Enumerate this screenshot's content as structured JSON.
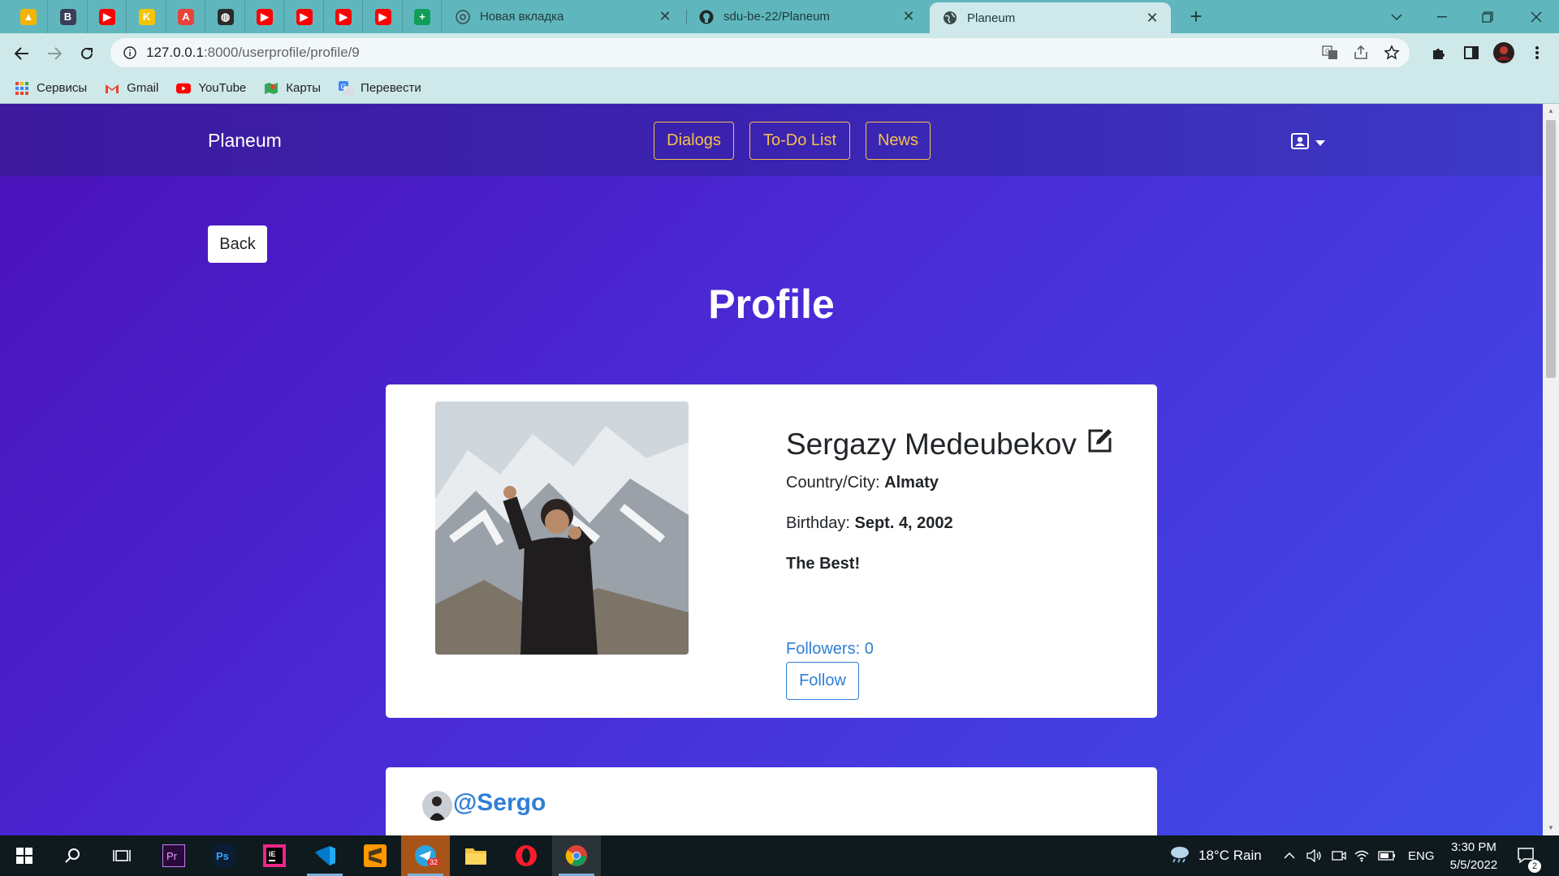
{
  "browser": {
    "tabs": [
      {
        "title": "Новая вкладка",
        "close": "✕"
      },
      {
        "title": "sdu-be-22/Planeum",
        "close": "✕"
      },
      {
        "title": "Planeum",
        "close": "✕"
      }
    ],
    "pinned_tabs": [
      {
        "icon": "google-drive-icon",
        "color": "#f4b400",
        "glyph": "▲"
      },
      {
        "icon": "b-app-icon",
        "color": "#3a3f58",
        "glyph": "B"
      },
      {
        "icon": "youtube-icon",
        "color": "#ff0000",
        "glyph": "▶"
      },
      {
        "icon": "k-app-icon",
        "color": "#f5c400",
        "glyph": "K"
      },
      {
        "icon": "translate-app-icon",
        "color": "#e8443a",
        "glyph": "A"
      },
      {
        "icon": "globe-icon",
        "color": "#2b2b2b",
        "glyph": "◍"
      },
      {
        "icon": "youtube-icon",
        "color": "#ff0000",
        "glyph": "▶"
      },
      {
        "icon": "youtube-icon",
        "color": "#ff0000",
        "glyph": "▶"
      },
      {
        "icon": "youtube-icon",
        "color": "#ff0000",
        "glyph": "▶"
      },
      {
        "icon": "youtube-icon",
        "color": "#ff0000",
        "glyph": "▶"
      },
      {
        "icon": "sheets-plus-icon",
        "color": "#0f9d58",
        "glyph": "+"
      }
    ],
    "url_host": "127.0.0.1",
    "url_path": ":8000/userprofile/profile/9",
    "bookmarks": [
      {
        "label": "Сервисы",
        "icon": "apps-grid-icon"
      },
      {
        "label": "Gmail",
        "icon": "gmail-icon"
      },
      {
        "label": "YouTube",
        "icon": "youtube-icon"
      },
      {
        "label": "Карты",
        "icon": "maps-icon"
      },
      {
        "label": "Перевести",
        "icon": "translate-icon"
      }
    ]
  },
  "site": {
    "brand": "Planeum",
    "nav": [
      "Dialogs",
      "To-Do List",
      "News"
    ],
    "back_label": "Back",
    "page_title": "Profile",
    "profile": {
      "name": "Sergazy Medeubekov",
      "country_label": "Country/City: ",
      "country_value": "Almaty",
      "birthday_label": "Birthday: ",
      "birthday_value": "Sept. 4, 2002",
      "bio": "The Best!",
      "followers": "Followers: 0",
      "follow_label": "Follow"
    },
    "post": {
      "handle": "@Sergo"
    }
  },
  "taskbar": {
    "weather": "18°C  Rain",
    "lang": "ENG",
    "time": "3:30 PM",
    "date": "5/5/2022",
    "telegram_badge": "32",
    "notifications": "2"
  },
  "colors": {
    "accent_gold": "#f6c04a",
    "link_blue": "#2f7fd6",
    "tab_strip": "#5fb7bd"
  }
}
